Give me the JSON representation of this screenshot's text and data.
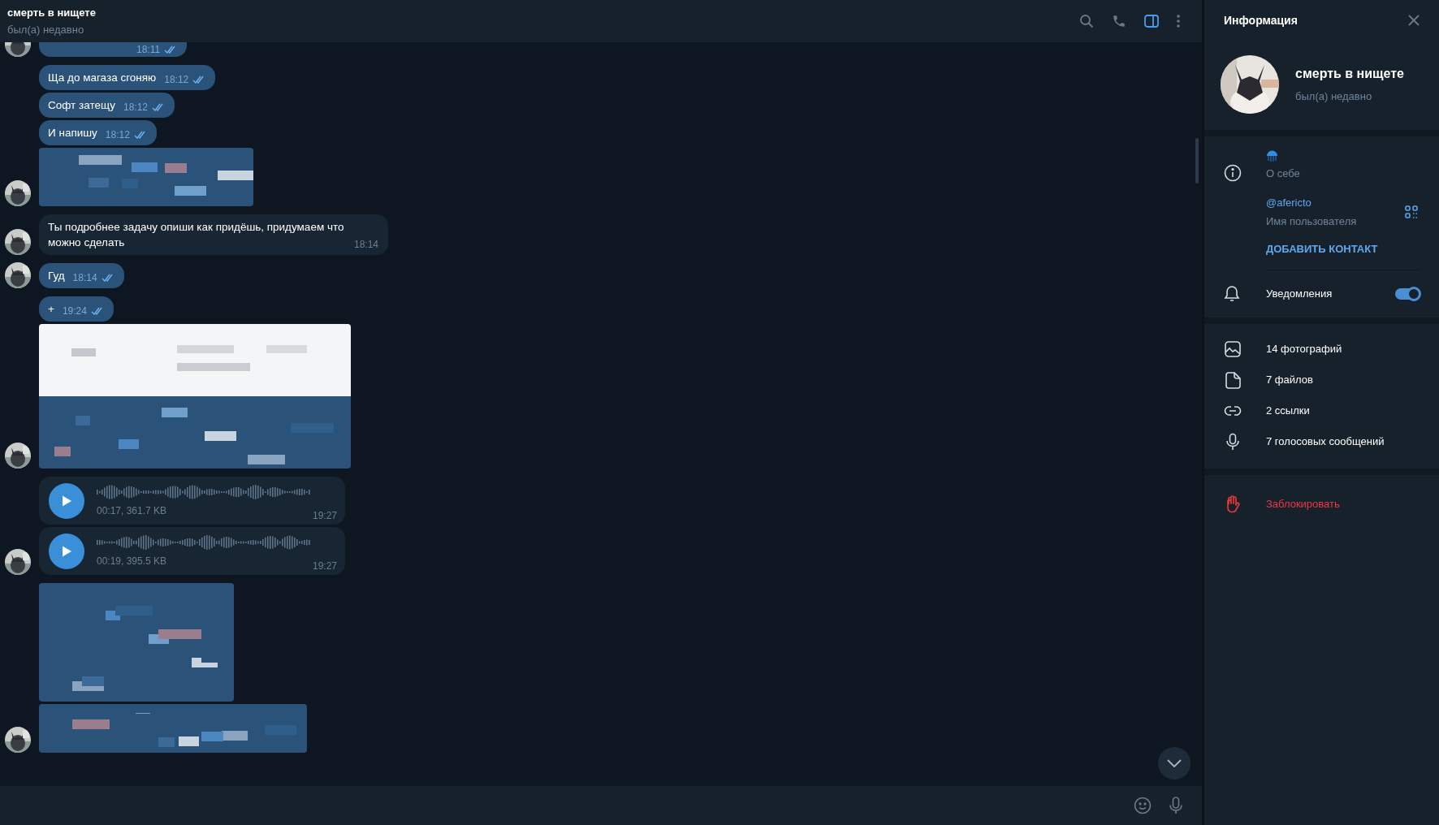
{
  "header": {
    "name": "смерть в нищете",
    "status": "был(а) недавно"
  },
  "messages": [
    {
      "kind": "text",
      "outgoing": true,
      "time": "18:11",
      "read": true,
      "avatar": true
    },
    {
      "kind": "text",
      "outgoing": true,
      "text": "Ща до магаза сгоняю",
      "time": "18:12",
      "read": true,
      "avatar": false
    },
    {
      "kind": "text",
      "outgoing": true,
      "text": "Софт затещу",
      "time": "18:12",
      "read": true,
      "avatar": false
    },
    {
      "kind": "text",
      "outgoing": true,
      "text": "И напишу",
      "time": "18:12",
      "read": true,
      "avatar": false
    },
    {
      "kind": "picture",
      "avatar": true
    },
    {
      "kind": "text",
      "outgoing": false,
      "text": "Ты подробнее задачу опиши как придёшь, придумаем что можно сделать",
      "time": "18:14",
      "avatar": true
    },
    {
      "kind": "text",
      "outgoing": true,
      "text": "Гуд",
      "time": "18:14",
      "read": true,
      "avatar": true
    },
    {
      "kind": "text",
      "outgoing": true,
      "text": "+",
      "time": "19:24",
      "read": true,
      "avatar": false
    },
    {
      "kind": "picture",
      "avatar": true
    },
    {
      "kind": "voice",
      "info": "00:17, 361.7 KB",
      "time": "19:27",
      "avatar": false
    },
    {
      "kind": "voice",
      "info": "00:19, 395.5 KB",
      "time": "19:27",
      "avatar": true
    },
    {
      "kind": "picture",
      "avatar": false
    },
    {
      "kind": "picture",
      "avatar": true
    }
  ],
  "panel": {
    "title": "Информация",
    "name": "смерть в нищете",
    "status": "был(а) недавно",
    "about_label": "О себе",
    "username": "@afericto",
    "username_label": "Имя пользователя",
    "add_contact": "ДОБАВИТЬ КОНТАКТ",
    "notifications": {
      "label": "Уведомления",
      "on": true
    },
    "media": [
      {
        "kind": "photos",
        "label": "14 фотографий"
      },
      {
        "kind": "files",
        "label": "7 файлов"
      },
      {
        "kind": "links",
        "label": "2 ссылки"
      },
      {
        "kind": "voice",
        "label": "7 голосовых сообщений"
      }
    ],
    "block": "Заблокировать"
  }
}
